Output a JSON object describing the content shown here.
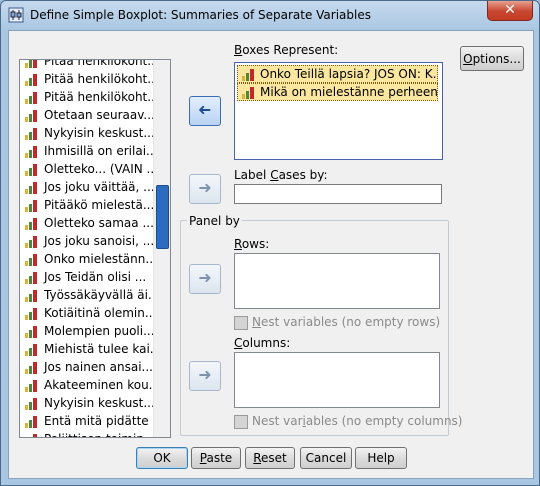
{
  "window": {
    "title": "Define Simple Boxplot: Summaries of Separate Variables",
    "close_label": "✕"
  },
  "variables": {
    "items": [
      "Pitää henkilökoht...",
      "Pitää henkilökoht...",
      "Pitää henkilökoht...",
      "Otetaan seuraav...",
      "Nykyisin keskust...",
      "Ihmisillä on erilai...",
      "Oletteko... (VAIN ...",
      "Jos joku väittää, ...",
      "Pitääkö mielestä...",
      "Oletteko samaa ...",
      "Jos joku sanoisi, ...",
      "Onko mielestänn...",
      "Jos Teidän olisi ...",
      "Työssäkäyvällä äi...",
      "Kotiäitinä olemin...",
      "Molempien puoli...",
      "Miehistä tulee kai...",
      "Jos nainen ansai...",
      "Akateeminen kou...",
      "Nykyisin keskust...",
      "Entä mitä pidätte ...",
      "Poliittisen toimin..."
    ]
  },
  "boxes": {
    "label_prefix": "",
    "label_u": "B",
    "label_rest": "oxes Represent:",
    "items": [
      "Onko Teillä lapsia? JOS ON: K...",
      "Mikä on mielestänne perheen i..."
    ]
  },
  "label_cases": {
    "prefix": "Label ",
    "u": "C",
    "rest": "ases by:",
    "value": ""
  },
  "panel": {
    "legend": "Panel by",
    "rows_prefix": "",
    "rows_u": "R",
    "rows_rest": "ows:",
    "nest_rows_prefix": "",
    "nest_rows_u": "N",
    "nest_rows_rest": "est variables (no empty rows)",
    "columns_prefix": "",
    "columns_u": "C",
    "columns_rest": "olumns:",
    "nest_cols_prefix": "Nest var",
    "nest_cols_u": "i",
    "nest_cols_rest": "ables (no empty columns)"
  },
  "buttons": {
    "options_prefix": "",
    "options_u": "O",
    "options_rest": "ptions...",
    "ok": "OK",
    "paste_prefix": "",
    "paste_u": "P",
    "paste_rest": "aste",
    "reset_prefix": "",
    "reset_u": "R",
    "reset_rest": "eset",
    "cancel": "Cancel",
    "help": "Help"
  },
  "arrow_glyph": "➜",
  "icons": {
    "window": "boxplot-icon",
    "variable": "scale-variable-icon"
  }
}
